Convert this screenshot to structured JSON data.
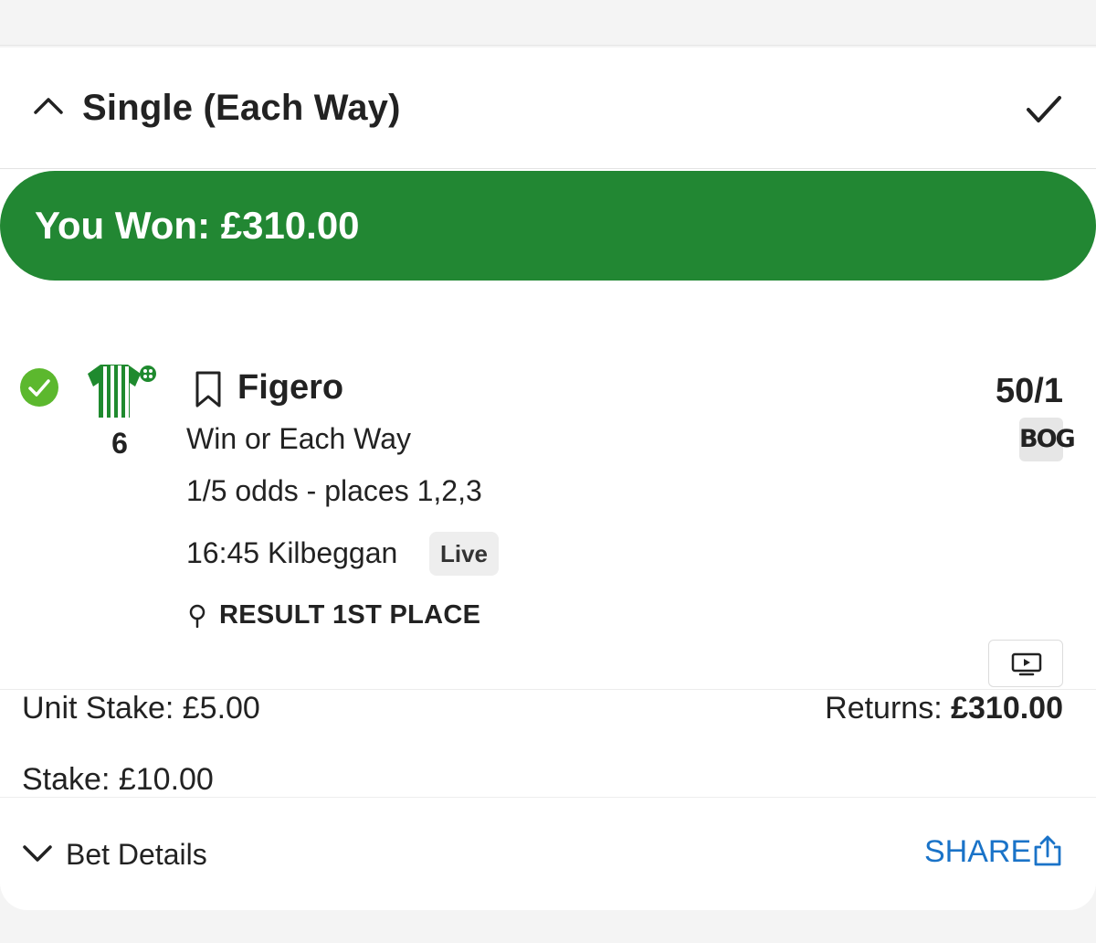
{
  "bet": {
    "type_title": "Single (Each Way)",
    "won_text": "You Won: £310.00"
  },
  "selection": {
    "runner_number": "6",
    "horse_name": "Figero",
    "odds": "50/1",
    "bog_label": "BOG",
    "market": "Win or Each Way",
    "each_way_terms": "1/5 odds - places 1,2,3",
    "race": "16:45 Kilbeggan",
    "live_label": "Live",
    "result": "RESULT 1ST PLACE"
  },
  "stakes": {
    "unit_stake": "Unit Stake: £5.00",
    "returns_label": "Returns:",
    "returns_value": "£310.00",
    "stake": "Stake: £10.00"
  },
  "footer": {
    "bet_details_label": "Bet Details",
    "share_label": "SHARE"
  },
  "colors": {
    "won_green": "#228733",
    "tick_green": "#5cb82e",
    "share_blue": "#1a73c8",
    "silk_green": "#1f8a2e"
  },
  "icons": [
    "chevron-up-icon",
    "checkmark-icon",
    "check-circle-icon",
    "jockey-silks-icon",
    "bookmark-icon",
    "location-pin-icon",
    "tv-play-icon",
    "chevron-down-icon",
    "share-icon"
  ]
}
